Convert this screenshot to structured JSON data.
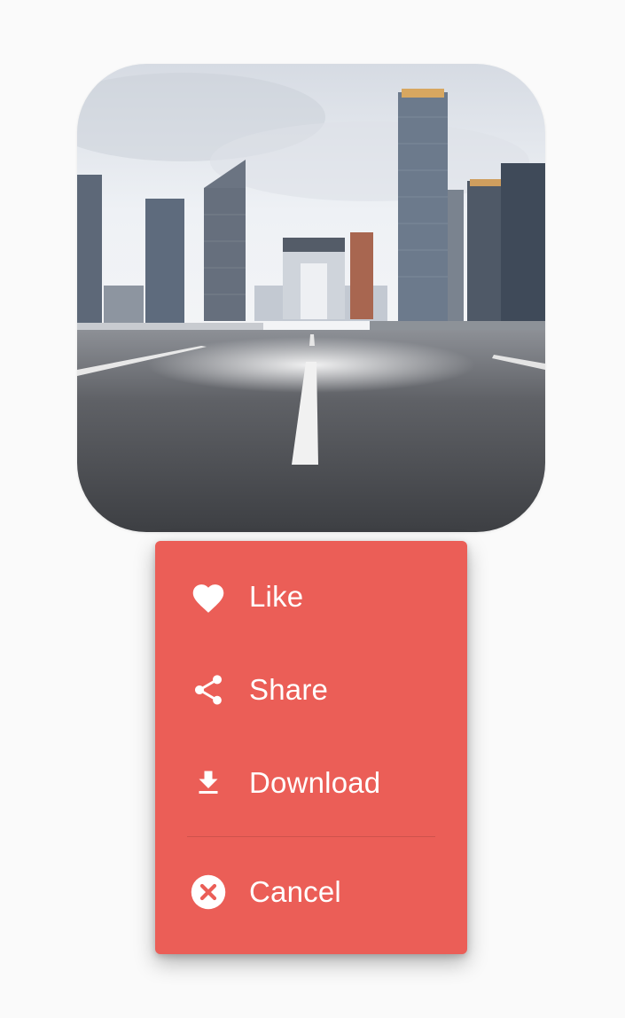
{
  "image": {
    "alt": "City road with skyscrapers",
    "icon": "photo"
  },
  "menu": {
    "background": "#eb5e57",
    "items": [
      {
        "label": "Like",
        "icon": "heart-icon"
      },
      {
        "label": "Share",
        "icon": "share-icon"
      },
      {
        "label": "Download",
        "icon": "download-icon"
      }
    ],
    "cancel": {
      "label": "Cancel",
      "icon": "cancel-icon"
    }
  }
}
